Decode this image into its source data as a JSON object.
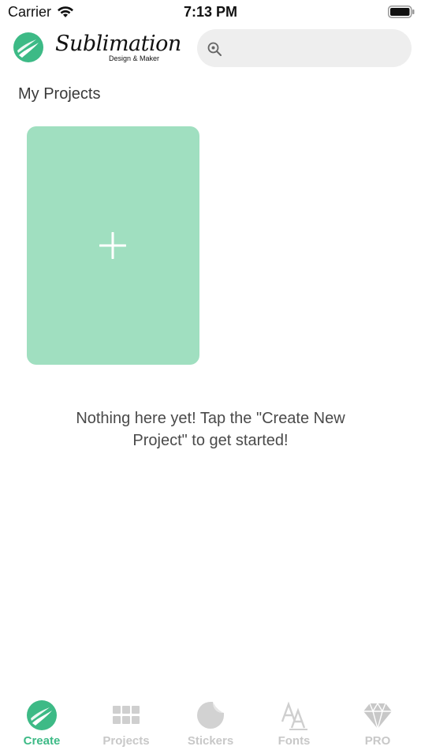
{
  "status_bar": {
    "carrier": "Carrier",
    "time": "7:13 PM"
  },
  "header": {
    "brand_name": "Sublimation",
    "brand_subtitle": "Design & Maker",
    "logo_icon": "leaf-logo-icon",
    "search": {
      "icon": "search-icon",
      "value": "",
      "placeholder": ""
    }
  },
  "main": {
    "section_title": "My Projects",
    "new_project_icon": "plus-icon",
    "empty_message": "Nothing here yet! Tap the \"Create New Project\" to get started!"
  },
  "tab_bar": {
    "tabs": [
      {
        "label": "Create",
        "icon": "leaf-logo-icon",
        "active": true
      },
      {
        "label": "Projects",
        "icon": "grid-icon",
        "active": false
      },
      {
        "label": "Stickers",
        "icon": "sticker-icon",
        "active": false
      },
      {
        "label": "Fonts",
        "icon": "font-icon",
        "active": false
      },
      {
        "label": "PRO",
        "icon": "diamond-icon",
        "active": false
      }
    ]
  },
  "colors": {
    "accent": "#3dba86",
    "card": "#a0dfc0",
    "search_bg": "#eeeeee",
    "inactive": "#c8c8c8"
  }
}
